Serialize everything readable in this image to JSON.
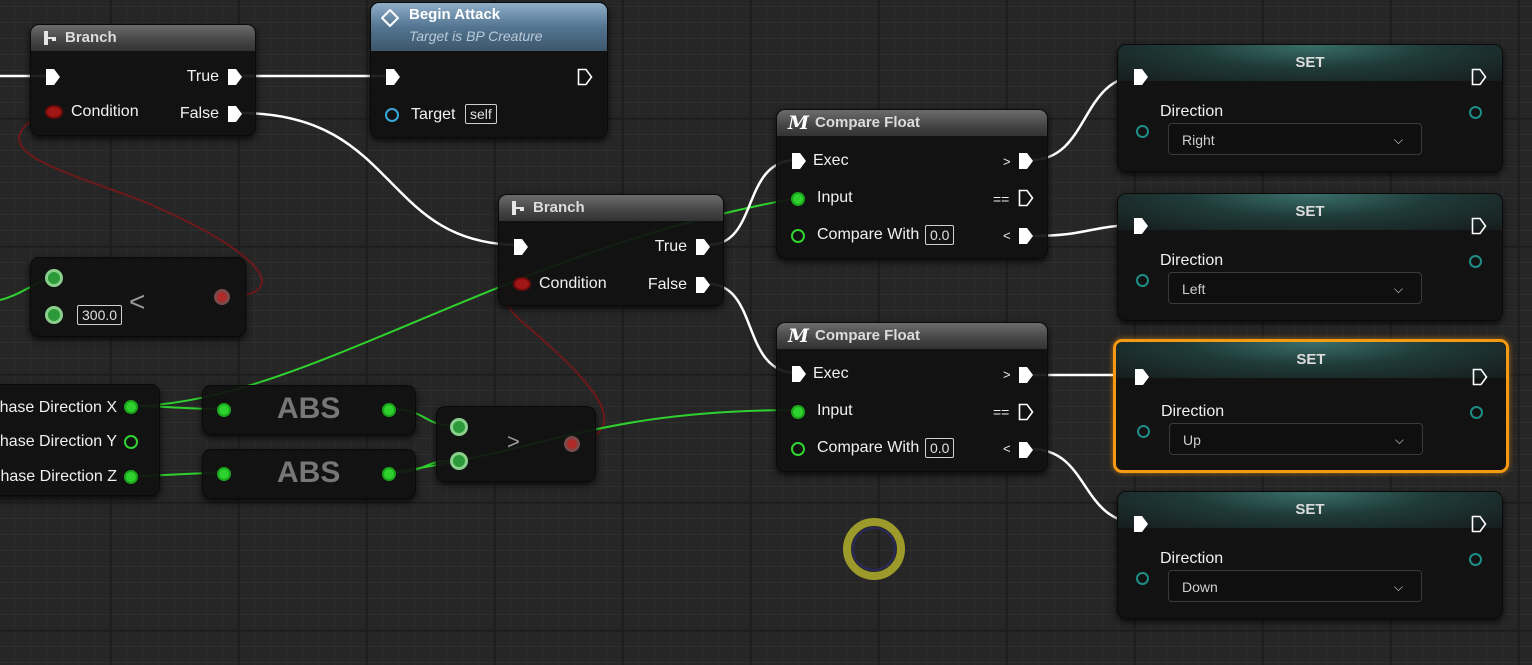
{
  "nodes": {
    "branch1": {
      "title": "Branch",
      "true_label": "True",
      "false_label": "False",
      "condition_label": "Condition"
    },
    "begin_attack": {
      "title": "Begin Attack",
      "subtitle": "Target is BP Creature",
      "target_label": "Target",
      "target_value": "self"
    },
    "less_node": {
      "value": "300.0",
      "operator": "<"
    },
    "branch2": {
      "title": "Branch",
      "true_label": "True",
      "false_label": "False",
      "condition_label": "Condition"
    },
    "compare1": {
      "title": "Compare Float",
      "exec_label": "Exec",
      "input_label": "Input",
      "compare_label": "Compare With",
      "compare_value": "0.0",
      "gt": ">",
      "eq": "==",
      "lt": "<"
    },
    "compare2": {
      "title": "Compare Float",
      "exec_label": "Exec",
      "input_label": "Input",
      "compare_label": "Compare With",
      "compare_value": "0.0",
      "gt": ">",
      "eq": "==",
      "lt": "<"
    },
    "phase": {
      "x": "hase Direction X",
      "y": "hase Direction Y",
      "z": "hase Direction Z"
    },
    "abs1": {
      "title": "ABS"
    },
    "abs2": {
      "title": "ABS"
    },
    "greater_node": {
      "operator": ">"
    },
    "set_nodes": [
      {
        "title": "SET",
        "var": "Direction",
        "value": "Right"
      },
      {
        "title": "SET",
        "var": "Direction",
        "value": "Left"
      },
      {
        "title": "SET",
        "var": "Direction",
        "value": "Up"
      },
      {
        "title": "SET",
        "var": "Direction",
        "value": "Down"
      }
    ]
  },
  "colors": {
    "exec_wire": "#ffffff",
    "float_wire": "#2fd12f",
    "bool_wire": "#8a1a1a",
    "selection": "#f59a12",
    "cursor_ring": "#9c9a2a"
  },
  "icons": {
    "branch": "branch-icon",
    "event": "diamond-event-icon",
    "macro": "macro-m-icon",
    "dropdown": "chevron-down-icon"
  }
}
